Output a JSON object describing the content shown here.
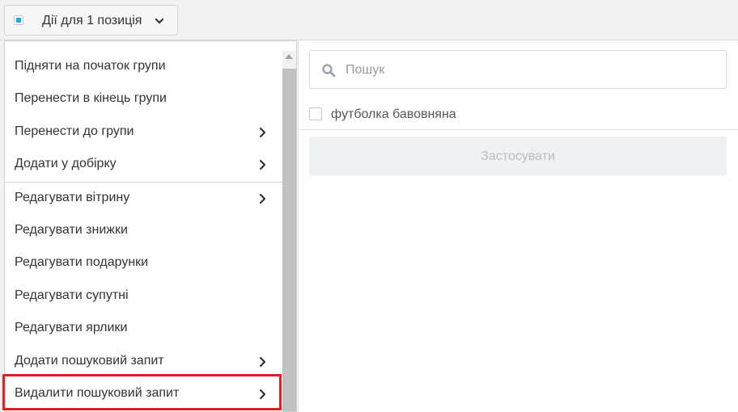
{
  "bulk_actions": {
    "label": "Дії для 1 позиція",
    "checkbox_state": "partial",
    "accent_color": "#1eaae7"
  },
  "menu": {
    "items": [
      {
        "label": "Підняти на початок групи",
        "has_submenu": false
      },
      {
        "label": "Перенести в кінець групи",
        "has_submenu": false
      },
      {
        "label": "Перенести до групи",
        "has_submenu": true
      },
      {
        "label": "Додати у добірку",
        "has_submenu": true
      },
      {
        "label": "Редагувати вітрину",
        "has_submenu": true
      },
      {
        "label": "Редагувати знижки",
        "has_submenu": false
      },
      {
        "label": "Редагувати подарунки",
        "has_submenu": false
      },
      {
        "label": "Редагувати супутні",
        "has_submenu": false
      },
      {
        "label": "Редагувати ярлики",
        "has_submenu": false
      },
      {
        "label": "Додати пошуковий запит",
        "has_submenu": true
      },
      {
        "label": "Видалити пошуковий запит",
        "has_submenu": true,
        "highlighted": true
      }
    ],
    "highlight_color": "#e0201e"
  },
  "panel": {
    "search_placeholder": "Пошук",
    "search_value": "",
    "options": [
      {
        "label": "футболка бавовняна",
        "checked": false
      }
    ],
    "apply_label": "Застосувати",
    "apply_enabled": false
  }
}
